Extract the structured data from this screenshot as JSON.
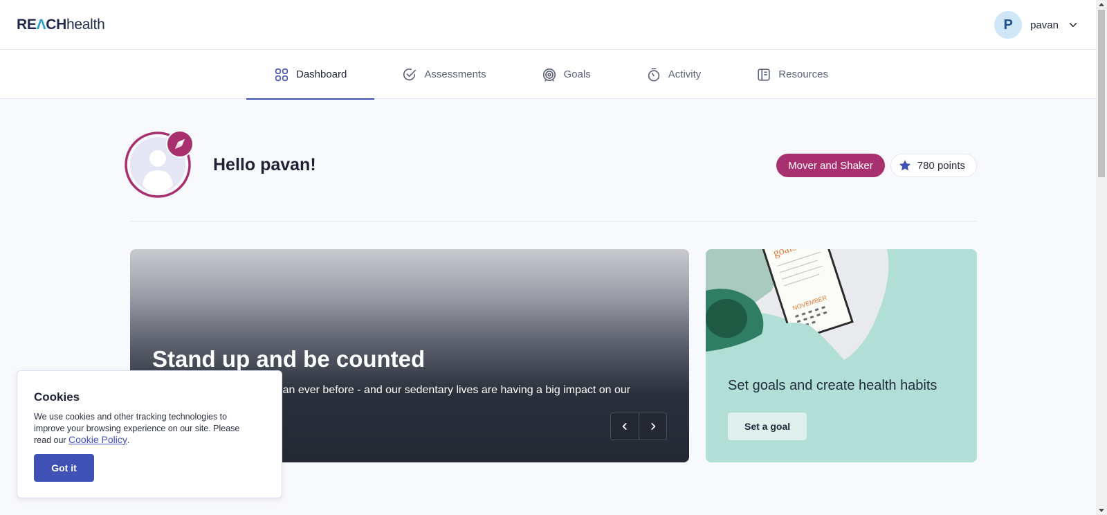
{
  "header": {
    "logo_bold": "RE",
    "logo_a": "Λ",
    "logo_rest": "CH",
    "logo_health": "health",
    "user_initial": "P",
    "user_name": "pavan"
  },
  "nav": {
    "tabs": [
      {
        "label": "Dashboard",
        "icon": "dashboard-grid-icon",
        "active": true
      },
      {
        "label": "Assessments",
        "icon": "check-circle-icon",
        "active": false
      },
      {
        "label": "Goals",
        "icon": "target-icon",
        "active": false
      },
      {
        "label": "Activity",
        "icon": "stopwatch-icon",
        "active": false
      },
      {
        "label": "Resources",
        "icon": "book-icon",
        "active": false
      }
    ]
  },
  "profile": {
    "greeting": "Hello pavan!",
    "level_badge": "Mover and Shaker",
    "points": "780 points"
  },
  "carousel": {
    "title": "Stand up and be counted",
    "text": "We're sitting down more than ever before - and our sedentary lives are having a big impact on our"
  },
  "goal_card": {
    "text": "Set goals and create health habits",
    "button": "Set a goal"
  },
  "cookie": {
    "title": "Cookies",
    "text": "We use cookies and other tracking technologies to improve your browsing experience on our site. Please read our ",
    "link": "Cookie Policy",
    "after_link": ".",
    "button": "Got it"
  },
  "colors": {
    "accent": "#3f51b5",
    "badge": "#a8306f",
    "goal_card_bg": "#b1dfd6"
  }
}
